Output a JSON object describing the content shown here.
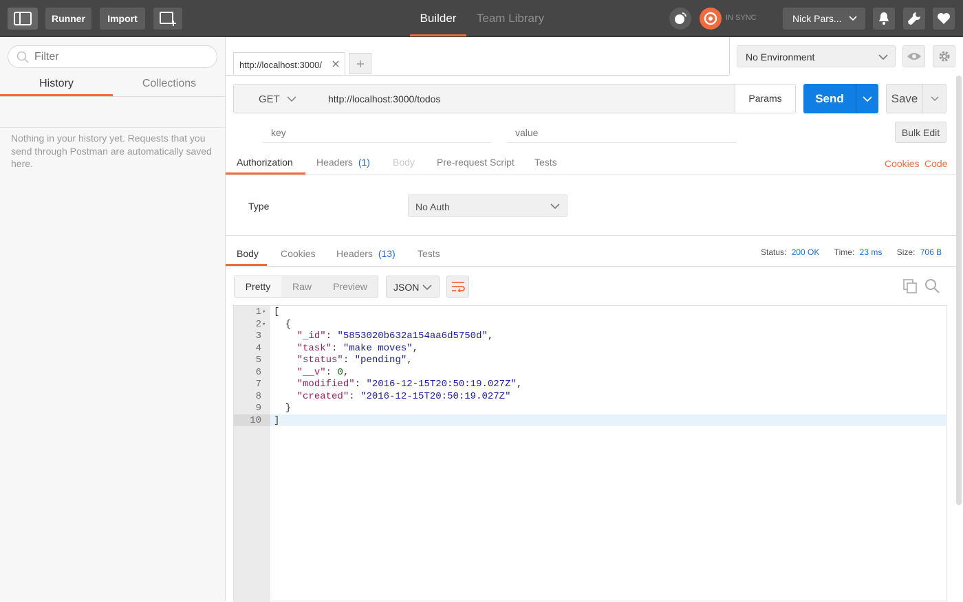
{
  "topbar": {
    "runner_label": "Runner",
    "import_label": "Import",
    "modes": [
      {
        "label": "Builder"
      },
      {
        "label": "Team Library"
      }
    ],
    "sync_label": "IN SYNC",
    "user_name": "Nick Pars..."
  },
  "sidebar": {
    "filter_placeholder": "Filter",
    "tabs": [
      {
        "label": "History"
      },
      {
        "label": "Collections"
      }
    ],
    "empty_message": "Nothing in your history yet. Requests that you send through Postman are automatically saved here."
  },
  "environment": {
    "selected": "No Environment"
  },
  "request_tab": {
    "title": "http://localhost:3000/"
  },
  "request": {
    "method": "GET",
    "url": "http://localhost:3000/todos",
    "params_label": "Params",
    "send_label": "Send",
    "save_label": "Save",
    "key_placeholder": "key",
    "value_placeholder": "value",
    "bulk_edit_label": "Bulk Edit",
    "tabs": [
      {
        "label": "Authorization"
      },
      {
        "label": "Headers",
        "count": "(1)"
      },
      {
        "label": "Body"
      },
      {
        "label": "Pre-request Script"
      },
      {
        "label": "Tests"
      }
    ],
    "cookies_link": "Cookies",
    "code_link": "Code",
    "auth_type_label": "Type",
    "auth_type_value": "No Auth"
  },
  "response": {
    "tabs": [
      {
        "label": "Body"
      },
      {
        "label": "Cookies"
      },
      {
        "label": "Headers",
        "count": "(13)"
      },
      {
        "label": "Tests"
      }
    ],
    "status_label": "Status:",
    "status_value": "200 OK",
    "time_label": "Time:",
    "time_value": "23 ms",
    "size_label": "Size:",
    "size_value": "706 B",
    "view_modes": [
      {
        "label": "Pretty"
      },
      {
        "label": "Raw"
      },
      {
        "label": "Preview"
      }
    ],
    "format": "JSON",
    "code_lines": [
      {
        "n": "1",
        "fold": "▾",
        "parts": [
          {
            "t": "[",
            "c": "p"
          }
        ]
      },
      {
        "n": "2",
        "fold": "▾",
        "parts": [
          {
            "t": "  {",
            "c": "p"
          }
        ]
      },
      {
        "n": "3",
        "fold": "",
        "parts": [
          {
            "t": "    ",
            "c": "p"
          },
          {
            "t": "\"_id\"",
            "c": "k"
          },
          {
            "t": ": ",
            "c": "p"
          },
          {
            "t": "\"5853020b632a154aa6d5750d\"",
            "c": "s"
          },
          {
            "t": ",",
            "c": "p"
          }
        ]
      },
      {
        "n": "4",
        "fold": "",
        "parts": [
          {
            "t": "    ",
            "c": "p"
          },
          {
            "t": "\"task\"",
            "c": "k"
          },
          {
            "t": ": ",
            "c": "p"
          },
          {
            "t": "\"make moves\"",
            "c": "s"
          },
          {
            "t": ",",
            "c": "p"
          }
        ]
      },
      {
        "n": "5",
        "fold": "",
        "parts": [
          {
            "t": "    ",
            "c": "p"
          },
          {
            "t": "\"status\"",
            "c": "k"
          },
          {
            "t": ": ",
            "c": "p"
          },
          {
            "t": "\"pending\"",
            "c": "s"
          },
          {
            "t": ",",
            "c": "p"
          }
        ]
      },
      {
        "n": "6",
        "fold": "",
        "parts": [
          {
            "t": "    ",
            "c": "p"
          },
          {
            "t": "\"__v\"",
            "c": "k"
          },
          {
            "t": ": ",
            "c": "p"
          },
          {
            "t": "0",
            "c": "n"
          },
          {
            "t": ",",
            "c": "p"
          }
        ]
      },
      {
        "n": "7",
        "fold": "",
        "parts": [
          {
            "t": "    ",
            "c": "p"
          },
          {
            "t": "\"modified\"",
            "c": "k"
          },
          {
            "t": ": ",
            "c": "p"
          },
          {
            "t": "\"2016-12-15T20:50:19.027Z\"",
            "c": "s"
          },
          {
            "t": ",",
            "c": "p"
          }
        ]
      },
      {
        "n": "8",
        "fold": "",
        "parts": [
          {
            "t": "    ",
            "c": "p"
          },
          {
            "t": "\"created\"",
            "c": "k"
          },
          {
            "t": ": ",
            "c": "p"
          },
          {
            "t": "\"2016-12-15T20:50:19.027Z\"",
            "c": "s"
          }
        ]
      },
      {
        "n": "9",
        "fold": "",
        "parts": [
          {
            "t": "  }",
            "c": "p"
          }
        ]
      },
      {
        "n": "10",
        "fold": "",
        "parts": [
          {
            "t": "]",
            "c": "p"
          }
        ]
      }
    ]
  },
  "colors": {
    "accent_orange": "#f26b3a",
    "send_blue": "#0f7fe6",
    "link_blue": "#1a6fdb",
    "json_key": "#a11a5b",
    "json_string": "#1a1aa6",
    "json_number": "#0d6e0d",
    "topbar_bg": "#464646"
  },
  "icons": {
    "sidebar_toggle": "sidebar-toggle-icon",
    "new_window": "new-window-icon",
    "interceptor": "satellite-icon",
    "sync": "sync-icon",
    "bell": "bell-icon",
    "wrench": "wrench-icon",
    "heart": "heart-icon",
    "eye": "eye-icon",
    "gear": "gear-icon",
    "copy": "copy-icon",
    "search": "search-icon",
    "wrap": "wrap-lines-icon"
  }
}
